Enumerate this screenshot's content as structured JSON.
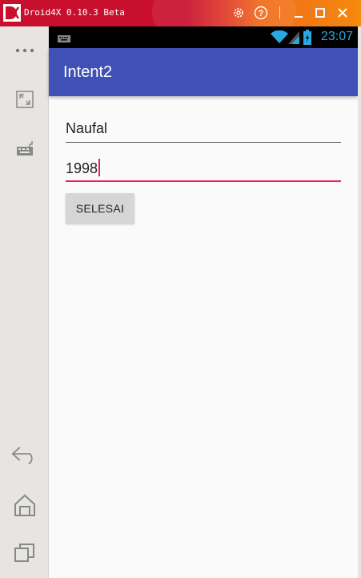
{
  "window": {
    "title": "Droid4X 0.10.3 Beta"
  },
  "statusbar": {
    "time": "23:07"
  },
  "app": {
    "title": "Intent2",
    "name_field": {
      "value": "Naufal"
    },
    "year_field": {
      "value": "1998"
    },
    "done_button": {
      "label": "SELESAI"
    }
  },
  "colors": {
    "titlebar_red": "#c8102e",
    "titlebar_orange": "#f48a0e",
    "appbar": "#3f51b5",
    "accent": "#e91e63",
    "clock": "#2aa8e0"
  },
  "icons": {
    "titlebar": [
      "droid4x-logo-icon",
      "settings-icon",
      "help-icon",
      "minimize-icon",
      "maximize-icon",
      "close-icon"
    ],
    "sidebar": [
      "more-icon",
      "fullscreen-icon",
      "keyboard-icon",
      "back-icon",
      "home-icon",
      "recent-apps-icon"
    ],
    "statusbar": [
      "keyboard-notification-icon",
      "wifi-icon",
      "signal-icon",
      "battery-icon"
    ]
  }
}
